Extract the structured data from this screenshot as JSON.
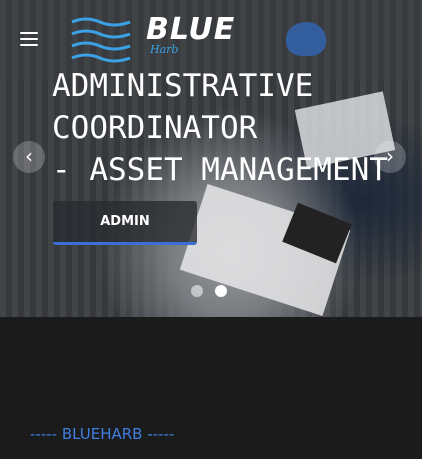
{
  "hero": {
    "title_lines": [
      "ADMINISTRATIVE",
      "COORDINATOR",
      "- ASSET MANAGEMENT"
    ],
    "button_label": "ADMIN",
    "prev_glyph": "‹",
    "next_glyph": "›"
  },
  "brand": {
    "name": "BLUE",
    "tagline": "Harb",
    "accent": "#3aa2e6"
  },
  "carousel": {
    "slide_count": 2,
    "active_index": 1
  },
  "section": {
    "label": "----- BLUEHARB -----"
  },
  "icons": {
    "menu": "hamburger-icon",
    "prev": "chevron-left-icon",
    "next": "chevron-right-icon"
  },
  "colors": {
    "button_accent": "#3b6fd4",
    "section_label": "#3f7fe0",
    "background": "#1b1b1c"
  }
}
